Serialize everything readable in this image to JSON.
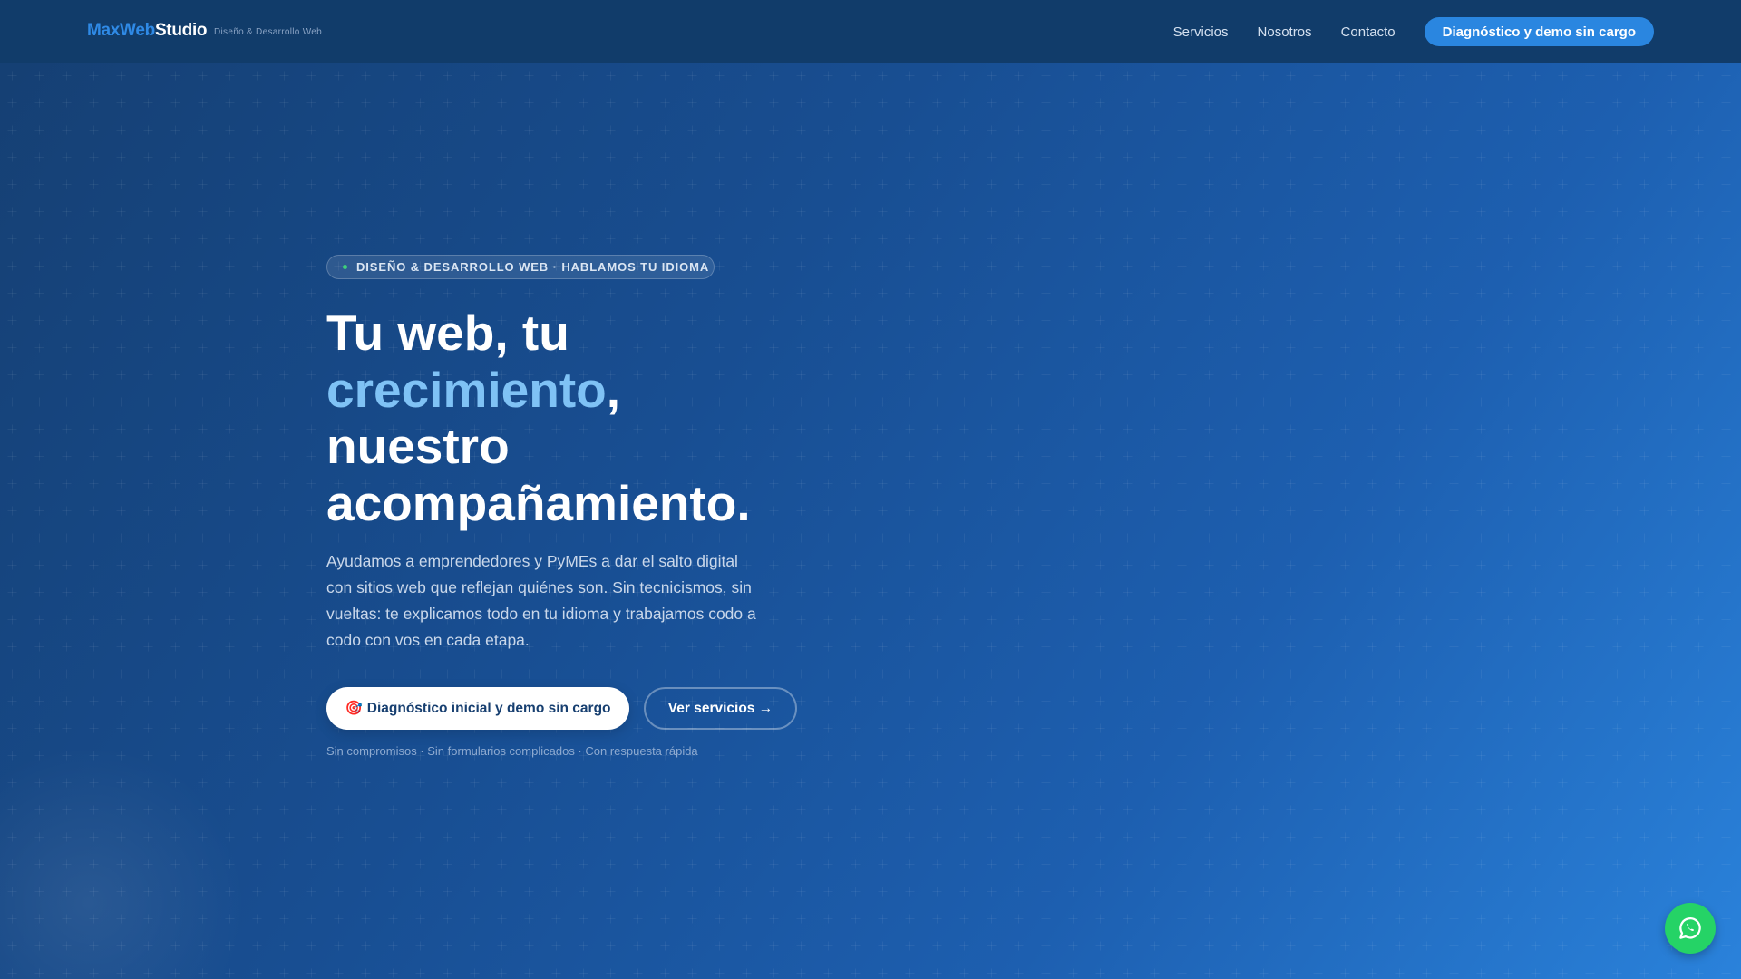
{
  "header": {
    "logo_part1": "MaxWeb",
    "logo_part2": "Studio",
    "tagline": "Diseño & Desarrollo Web",
    "nav": [
      "Servicios",
      "Nosotros",
      "Contacto"
    ],
    "cta": "Diagnóstico y demo sin cargo"
  },
  "hero": {
    "badge": "DISEÑO & DESARROLLO WEB · HABLAMOS TU IDIOMA",
    "title_1": "Tu web, tu",
    "title_highlight": "crecimiento",
    "title_2": ",",
    "title_3": "nuestro acompañamiento.",
    "lead": "Ayudamos a emprendedores y PyMEs a dar el salto digital con sitios web que reflejan quiénes son. Sin tecnicismos, sin vueltas: te explicamos todo en tu idioma y trabajamos codo a codo con vos en cada etapa.",
    "primary_icon": "🎯",
    "primary_button": "Diagnóstico inicial y demo sin cargo",
    "secondary_button": "Ver servicios →",
    "note": "Sin compromisos · Sin formularios complicados · Con respuesta rápida"
  },
  "colors": {
    "accent": "#2a86e0",
    "highlight": "#7fc2f5",
    "whatsapp": "#25d366"
  }
}
